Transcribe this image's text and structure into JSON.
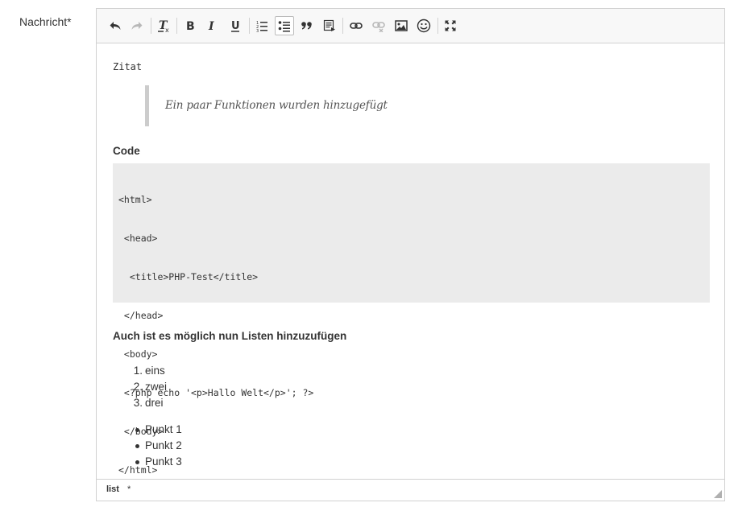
{
  "field": {
    "label": "Nachricht*"
  },
  "toolbar": {
    "buttons": [
      {
        "name": "undo-button",
        "icon": "undo-icon",
        "state": "enabled"
      },
      {
        "name": "redo-button",
        "icon": "redo-icon",
        "state": "disabled"
      },
      {
        "name": "remove-format-button",
        "icon": "remove-format-icon",
        "state": "enabled"
      },
      {
        "name": "bold-button",
        "icon": "bold-icon",
        "state": "enabled"
      },
      {
        "name": "italic-button",
        "icon": "italic-icon",
        "state": "enabled"
      },
      {
        "name": "underline-button",
        "icon": "underline-icon",
        "state": "enabled"
      },
      {
        "name": "numbered-list-button",
        "icon": "numbered-list-icon",
        "state": "enabled"
      },
      {
        "name": "bulleted-list-button",
        "icon": "bulleted-list-icon",
        "state": "active"
      },
      {
        "name": "blockquote-button",
        "icon": "quote-icon",
        "state": "enabled"
      },
      {
        "name": "code-snippet-button",
        "icon": "code-snippet-icon",
        "state": "enabled"
      },
      {
        "name": "link-button",
        "icon": "link-icon",
        "state": "enabled"
      },
      {
        "name": "unlink-button",
        "icon": "unlink-icon",
        "state": "disabled"
      },
      {
        "name": "image-button",
        "icon": "image-icon",
        "state": "enabled"
      },
      {
        "name": "emoji-button",
        "icon": "smiley-icon",
        "state": "enabled"
      },
      {
        "name": "maximize-button",
        "icon": "maximize-icon",
        "state": "enabled"
      }
    ]
  },
  "content": {
    "zitat_heading": "Zitat",
    "blockquote_text": "Ein paar Funktionen wurden hinzugefügt",
    "code_heading": "Code",
    "code_lines": [
      "<html>",
      " <head>",
      "  <title>PHP-Test</title>",
      " </head>",
      " <body>",
      " <?php echo '<p>Hallo Welt</p>'; ?>",
      " </body>",
      "</html>"
    ],
    "lists_heading": "Auch ist es möglich nun Listen hinzuzufügen",
    "ordered_list": {
      "markers": [
        "1.",
        "2.",
        "3."
      ],
      "items": [
        "eins",
        "zwei",
        "drei"
      ]
    },
    "bullet_list": {
      "items": [
        "Punkt 1",
        "Punkt 2",
        "Punkt 3"
      ]
    }
  },
  "statusbar": {
    "path": "list",
    "modified_marker": "*"
  },
  "colors": {
    "toolbar_bg": "#f8f8f8",
    "border": "#d1d1d1",
    "code_bg": "#ebebeb",
    "quote_bar": "#cccccc",
    "disabled_icon": "#b8b8b8"
  }
}
